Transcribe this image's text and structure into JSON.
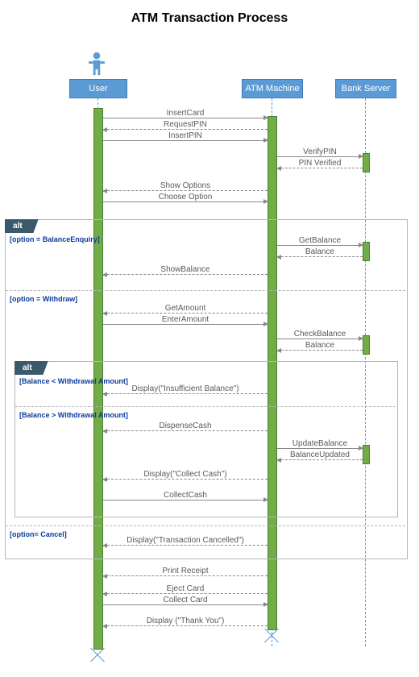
{
  "title": "ATM Transaction Process",
  "participants": {
    "user": "User",
    "atm": "ATM Machine",
    "bank": "Bank Server"
  },
  "messages": {
    "m1": "InsertCard",
    "m2": "RequestPIN",
    "m3": "InsertPIN",
    "m4": "VerifyPIN",
    "m5": "PIN Verified",
    "m6": "Show Options",
    "m7": "Choose Option",
    "m8": "GetBalance",
    "m9": "Balance",
    "m10": "ShowBalance",
    "m11": "GetAmount",
    "m12": "EnterAmount",
    "m13": "CheckBalance",
    "m14": "Balance",
    "m15": "Display(\"Insufficient Balance\")",
    "m16": "DispenseCash",
    "m17": "UpdateBalance",
    "m18": "BalanceUpdated",
    "m19": "Display(\"Collect Cash\")",
    "m20": "CollectCash",
    "m21": "Display(\"Transaction Cancelled\")",
    "m22": "Print Receipt",
    "m23": "Eject Card",
    "m24": "Collect Card",
    "m25": "Display (\"Thank You\")"
  },
  "fragments": {
    "alt1": "alt",
    "alt2": "alt"
  },
  "guards": {
    "g1": "[option = BalanceEnquiry]",
    "g2": "[option = Withdraw]",
    "g3": "[Balance < Withdrawal Amount]",
    "g4": "[Balance > Withdrawal Amount]",
    "g5": "[option= Cancel]"
  },
  "chart_data": {
    "type": "sequence-diagram",
    "title": "ATM Transaction Process",
    "participants": [
      "User",
      "ATM Machine",
      "Bank Server"
    ],
    "messages": [
      {
        "from": "User",
        "to": "ATM Machine",
        "text": "InsertCard",
        "style": "sync"
      },
      {
        "from": "ATM Machine",
        "to": "User",
        "text": "RequestPIN",
        "style": "return"
      },
      {
        "from": "User",
        "to": "ATM Machine",
        "text": "InsertPIN",
        "style": "sync"
      },
      {
        "from": "ATM Machine",
        "to": "Bank Server",
        "text": "VerifyPIN",
        "style": "sync"
      },
      {
        "from": "Bank Server",
        "to": "ATM Machine",
        "text": "PIN Verified",
        "style": "return"
      },
      {
        "from": "ATM Machine",
        "to": "User",
        "text": "Show Options",
        "style": "return"
      },
      {
        "from": "User",
        "to": "ATM Machine",
        "text": "Choose Option",
        "style": "sync"
      }
    ],
    "fragments": [
      {
        "type": "alt",
        "guards": [
          "option = BalanceEnquiry",
          "option = Withdraw",
          "option= Cancel"
        ],
        "regions": [
          [
            {
              "from": "ATM Machine",
              "to": "Bank Server",
              "text": "GetBalance",
              "style": "sync"
            },
            {
              "from": "Bank Server",
              "to": "ATM Machine",
              "text": "Balance",
              "style": "return"
            },
            {
              "from": "ATM Machine",
              "to": "User",
              "text": "ShowBalance",
              "style": "return"
            }
          ],
          [
            {
              "from": "ATM Machine",
              "to": "User",
              "text": "GetAmount",
              "style": "return"
            },
            {
              "from": "User",
              "to": "ATM Machine",
              "text": "EnterAmount",
              "style": "sync"
            },
            {
              "from": "ATM Machine",
              "to": "Bank Server",
              "text": "CheckBalance",
              "style": "sync"
            },
            {
              "from": "Bank Server",
              "to": "ATM Machine",
              "text": "Balance",
              "style": "return"
            },
            {
              "type": "alt",
              "guards": [
                "Balance < Withdrawal Amount",
                "Balance > Withdrawal Amount"
              ],
              "regions": [
                [
                  {
                    "from": "ATM Machine",
                    "to": "User",
                    "text": "Display(\"Insufficient Balance\")",
                    "style": "return"
                  }
                ],
                [
                  {
                    "from": "ATM Machine",
                    "to": "User",
                    "text": "DispenseCash",
                    "style": "return"
                  },
                  {
                    "from": "ATM Machine",
                    "to": "Bank Server",
                    "text": "UpdateBalance",
                    "style": "sync"
                  },
                  {
                    "from": "Bank Server",
                    "to": "ATM Machine",
                    "text": "BalanceUpdated",
                    "style": "return"
                  },
                  {
                    "from": "ATM Machine",
                    "to": "User",
                    "text": "Display(\"Collect Cash\")",
                    "style": "return"
                  },
                  {
                    "from": "User",
                    "to": "ATM Machine",
                    "text": "CollectCash",
                    "style": "sync"
                  }
                ]
              ]
            }
          ],
          [
            {
              "from": "ATM Machine",
              "to": "User",
              "text": "Display(\"Transaction Cancelled\")",
              "style": "return"
            }
          ]
        ]
      }
    ],
    "postlude": [
      {
        "from": "ATM Machine",
        "to": "User",
        "text": "Print Receipt",
        "style": "return"
      },
      {
        "from": "ATM Machine",
        "to": "User",
        "text": "Eject Card",
        "style": "return"
      },
      {
        "from": "User",
        "to": "ATM Machine",
        "text": "Collect Card",
        "style": "sync"
      },
      {
        "from": "ATM Machine",
        "to": "User",
        "text": "Display (\"Thank You\")",
        "style": "return"
      }
    ]
  }
}
